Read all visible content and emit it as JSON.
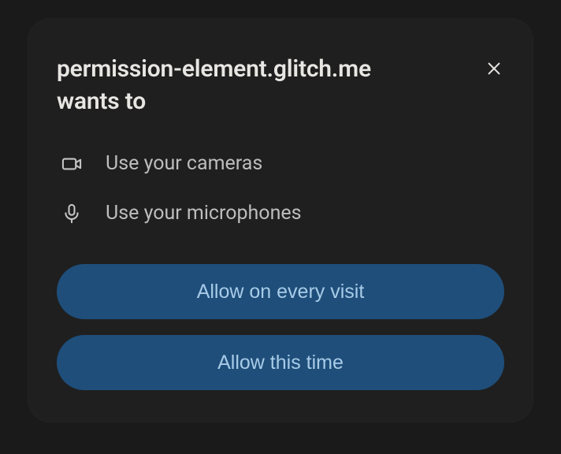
{
  "dialog": {
    "title_line1": "permission-element.glitch.me",
    "title_line2": "wants to",
    "close_aria": "Close"
  },
  "permissions": [
    {
      "icon": "camera-icon",
      "label": "Use your cameras"
    },
    {
      "icon": "microphone-icon",
      "label": "Use your microphones"
    }
  ],
  "buttons": {
    "allow_every": "Allow on every visit",
    "allow_once": "Allow this time"
  }
}
